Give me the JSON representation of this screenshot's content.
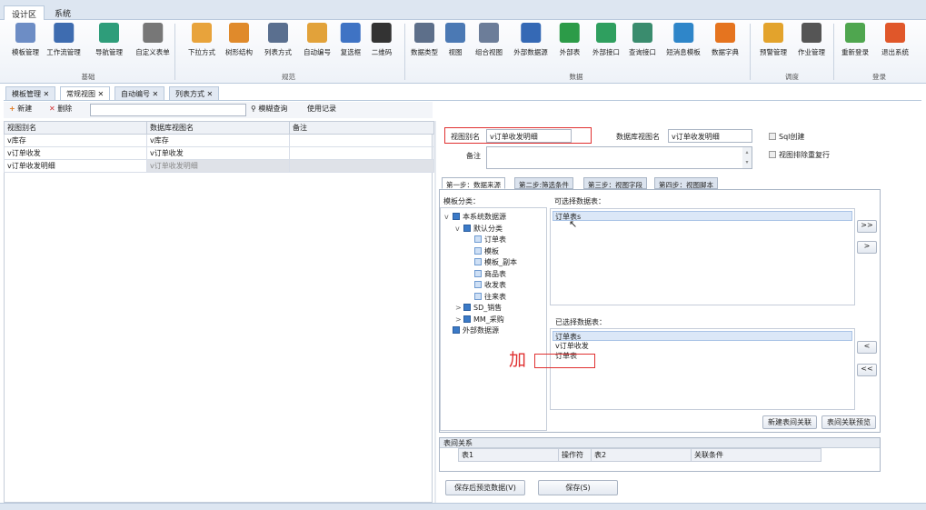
{
  "ribbon_tabs": [
    "设计区",
    "系统"
  ],
  "ribbon_tools": [
    {
      "label": "模板管理",
      "icon": "template-icon",
      "color": "#6d8dc5"
    },
    {
      "label": "工作流管理",
      "icon": "workflow-icon",
      "color": "#3e6cb0"
    },
    {
      "label": "导航管理",
      "icon": "navigation-icon",
      "color": "#2e9d7a"
    },
    {
      "label": "自定义表单",
      "icon": "cube-icon",
      "color": "#777777"
    },
    {
      "label": "下拉方式",
      "icon": "dropdown-icon",
      "color": "#e8a33b"
    },
    {
      "label": "树形结构",
      "icon": "tree-icon",
      "color": "#e08a2b"
    },
    {
      "label": "列表方式",
      "icon": "list-icon",
      "color": "#5a6f8f"
    },
    {
      "label": "自动编号",
      "icon": "auto-number-icon",
      "color": "#e2a23a"
    },
    {
      "label": "复选框",
      "icon": "checkbox-icon",
      "color": "#3f73c4"
    },
    {
      "label": "二维码",
      "icon": "qrcode-icon",
      "color": "#333333"
    },
    {
      "label": "数据类型",
      "icon": "data-type-icon",
      "color": "#5d6f8a"
    },
    {
      "label": "视图",
      "icon": "view-icon",
      "color": "#4b79b4"
    },
    {
      "label": "组合视图",
      "icon": "combined-view-icon",
      "color": "#6c7d99"
    },
    {
      "label": "外部数据源",
      "icon": "external-datasource-icon",
      "color": "#3569b5"
    },
    {
      "label": "外部表",
      "icon": "external-table-icon",
      "color": "#2c9b48"
    },
    {
      "label": "外部接口",
      "icon": "external-interface-icon",
      "color": "#2f9f5f"
    },
    {
      "label": "查询接口",
      "icon": "query-interface-icon",
      "color": "#3a8c6e"
    },
    {
      "label": "短消息模板",
      "icon": "message-template-icon",
      "color": "#2f86c9"
    },
    {
      "label": "数据字典",
      "icon": "data-dictionary-icon",
      "color": "#e5741f"
    },
    {
      "label": "预警管理",
      "icon": "warning-icon",
      "color": "#e3a32c"
    },
    {
      "label": "作业管理",
      "icon": "job-icon",
      "color": "#555555"
    },
    {
      "label": "重新登录",
      "icon": "relogin-icon",
      "color": "#4fa64f"
    },
    {
      "label": "退出系统",
      "icon": "power-icon",
      "color": "#e0572a"
    }
  ],
  "ribbon_groups": [
    "基础",
    "规范",
    "数据",
    "调度",
    "登录"
  ],
  "doc_tabs": [
    "模板管理",
    "常规视图",
    "自动编号",
    "列表方式"
  ],
  "toolbar": {
    "new_label": "新建",
    "delete_label": "删除",
    "fuzzy_query_label": "模糊查询",
    "usage_label": "使用记录"
  },
  "list": {
    "headers": [
      "视图别名",
      "数据库视图名",
      "备注"
    ],
    "rows": [
      [
        "v库存",
        "v库存",
        ""
      ],
      [
        "v订单收发",
        "v订单收发",
        ""
      ],
      [
        "v订单收发明细",
        "v订单收发明细",
        ""
      ]
    ]
  },
  "form": {
    "alias_label": "视图别名",
    "alias_value": "v订单收发明细",
    "dbname_label": "数据库视图名",
    "dbname_value": "v订单收发明细",
    "sql_label": "Sql创建",
    "dedupe_label": "视图排除重复行",
    "remark_label": "备注"
  },
  "steps": [
    "第一步：数据来源",
    "第二步:筛选条件",
    "第三步：视图字段",
    "第四步：视图脚本"
  ],
  "tree": {
    "title": "模板分类：",
    "nodes": [
      {
        "label": "本系统数据源",
        "level": 0,
        "folder": true,
        "exp": "v"
      },
      {
        "label": "默认分类",
        "level": 1,
        "folder": true,
        "exp": "v"
      },
      {
        "label": "订单表",
        "level": 2,
        "folder": false,
        "exp": ""
      },
      {
        "label": "模板",
        "level": 2,
        "folder": false,
        "exp": ""
      },
      {
        "label": "模板_副本",
        "level": 2,
        "folder": false,
        "exp": ""
      },
      {
        "label": "商品表",
        "level": 2,
        "folder": false,
        "exp": ""
      },
      {
        "label": "收发表",
        "level": 2,
        "folder": false,
        "exp": ""
      },
      {
        "label": "往来表",
        "level": 2,
        "folder": false,
        "exp": ""
      },
      {
        "label": "SD_销售",
        "level": 1,
        "folder": true,
        "exp": ">"
      },
      {
        "label": "MM_采购",
        "level": 1,
        "folder": true,
        "exp": ">"
      },
      {
        "label": "外部数据源",
        "level": 0,
        "folder": true,
        "exp": ""
      }
    ]
  },
  "available": {
    "title": "可选择数据表：",
    "items": [
      "订单表s"
    ]
  },
  "selected": {
    "title": "已选择数据表：",
    "items": [
      "订单表s",
      "v订单收发",
      "订单表"
    ]
  },
  "buttons": {
    "all_right": ">>",
    "right": ">",
    "left": "<",
    "all_left": "<<",
    "new_relation": "新建表间关联",
    "preview_relation": "表间关联预览",
    "save_preview": "保存后预览数据(V)",
    "save": "保存(S)"
  },
  "relation": {
    "title": "表间关系",
    "headers": [
      "表1",
      "操作符",
      "表2",
      "关联条件"
    ]
  },
  "annotation": "加"
}
